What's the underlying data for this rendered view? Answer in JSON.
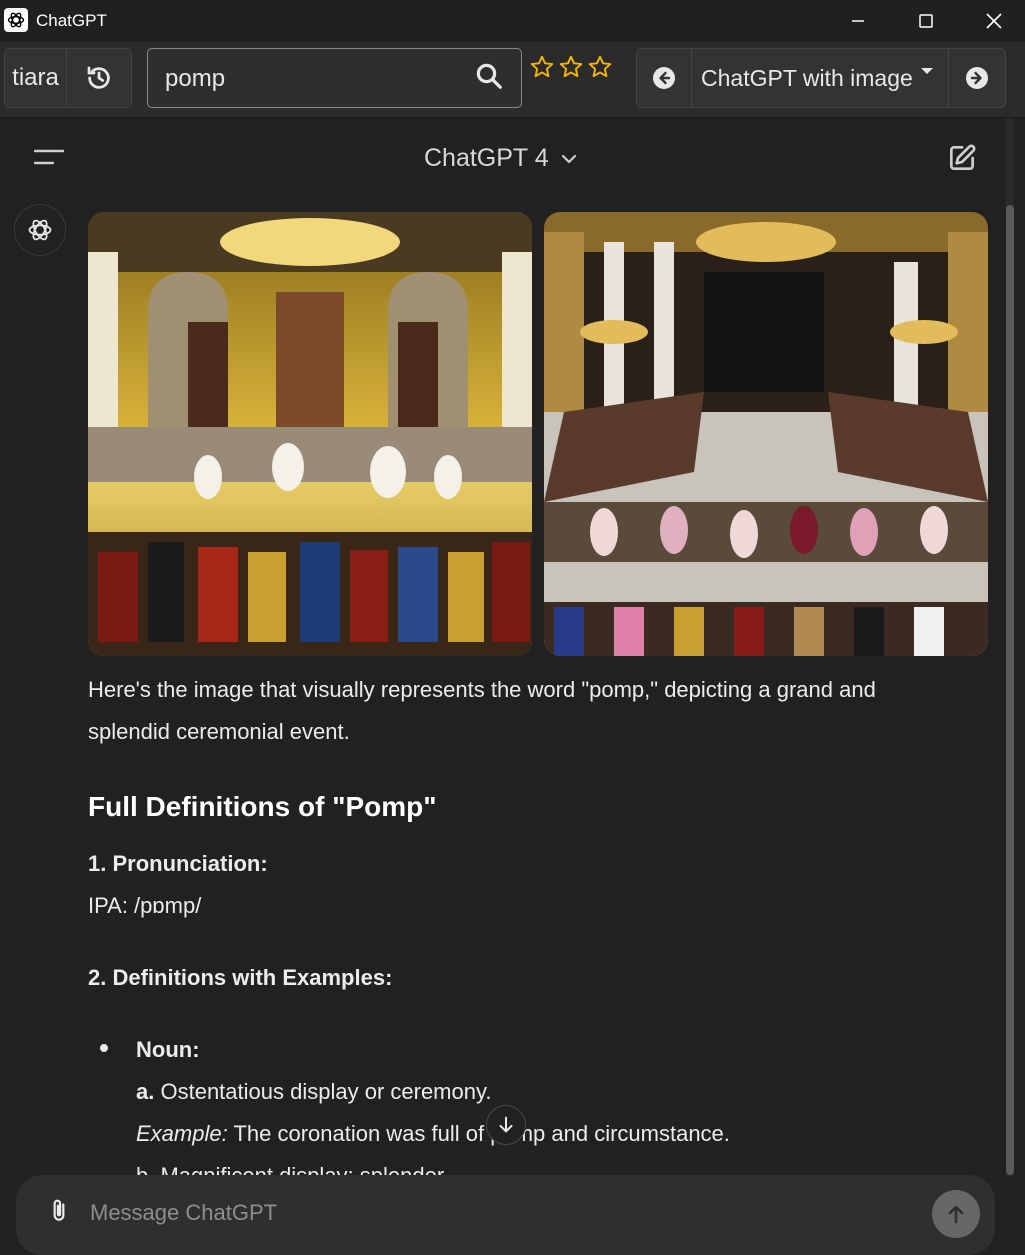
{
  "window": {
    "title": "ChatGPT"
  },
  "toolbar": {
    "tiara_label": "tiara",
    "search_value": "pomp",
    "rating_stars": 3,
    "dropdown_label": "ChatGPT with image"
  },
  "chat": {
    "model_title": "ChatGPT 4",
    "paragraph_line1": "Here's the image that visually represents the word \"pomp,\" depicting a grand and",
    "paragraph_line2": "splendid ceremonial event.",
    "heading": "Full Definitions of \"Pomp\"",
    "section1_title": "1. Pronunciation:",
    "ipa": "IPA: /pɒmp/",
    "section2_title": "2. Definitions with Examples:",
    "noun_label": "Noun:",
    "def_a_marker": "a.",
    "def_a_text": "Ostentatious display or ceremony.",
    "example_label": "Example:",
    "example_text": "The coronation was full of pomp and circumstance.",
    "def_b_partial": "b. Magnificent display; splendor."
  },
  "composer": {
    "placeholder": "Message ChatGPT"
  },
  "colors": {
    "background": "#212121",
    "toolbar": "#2b2b2b",
    "star": "#f5b400",
    "text": "#ececec"
  }
}
